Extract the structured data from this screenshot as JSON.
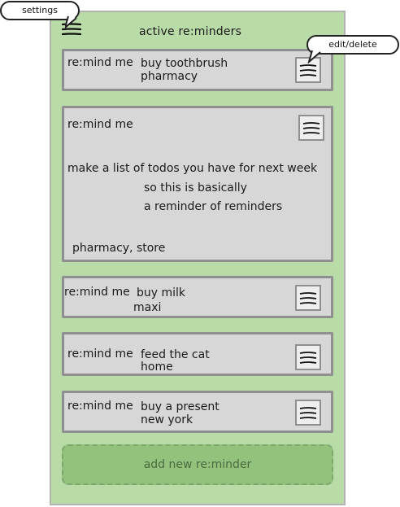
{
  "header": {
    "title": "active re:minders"
  },
  "callouts": {
    "settings": "settings",
    "edit_delete": "edit/delete"
  },
  "reminders": [
    {
      "label": "re:mind me",
      "lines": [
        "buy toothbrush",
        "pharmacy"
      ]
    },
    {
      "label": "re:mind me",
      "lines": [
        "make a list of todos you have for next week",
        "so this is basically",
        "a reminder of reminders",
        "pharmacy, store"
      ]
    },
    {
      "label": "re:mind me",
      "lines": [
        "buy milk",
        "maxi"
      ]
    },
    {
      "label": "re:mind me",
      "lines": [
        "feed the cat",
        "home"
      ]
    },
    {
      "label": "re:mind me",
      "lines": [
        "buy a present",
        "new york"
      ]
    }
  ],
  "add_button": {
    "label": "add new re:minder"
  },
  "icons": {
    "settings": "hamburger-menu-icon",
    "item_menu": "list-menu-icon"
  },
  "colors": {
    "background": "#b9dba7",
    "card": "#d7d7d7",
    "card_border": "#8f8f8f",
    "add_button": "#92c27c"
  }
}
